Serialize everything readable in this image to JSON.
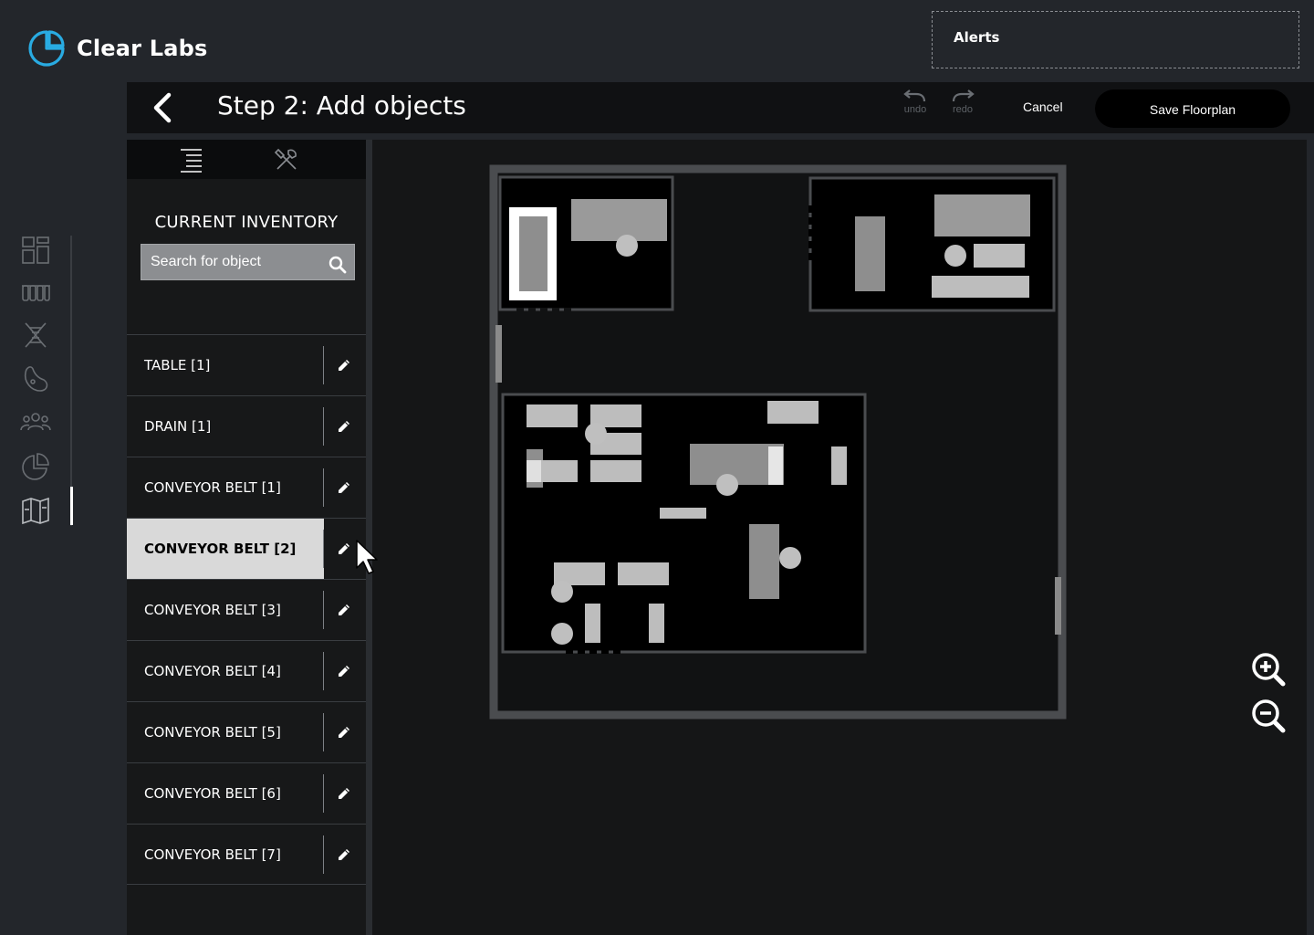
{
  "brand": {
    "name": "Clear Labs",
    "accent": "#29abe2"
  },
  "alerts": {
    "label": "Alerts"
  },
  "nav": {
    "icons": [
      "dashboard-icon",
      "test-tubes-icon",
      "dna-icon",
      "bacteria-icon",
      "users-icon",
      "pie-chart-icon",
      "floorplan-map-icon"
    ],
    "active": "floorplan-map-icon"
  },
  "header": {
    "title": "Step 2: Add objects",
    "undo": "undo",
    "redo": "redo",
    "cancel": "Cancel",
    "save": "Save Floorplan"
  },
  "sidebar": {
    "tabs": [
      "list-icon",
      "tools-icon"
    ],
    "title": "CURRENT INVENTORY",
    "search_placeholder": "Search for object",
    "items": [
      {
        "label": "TABLE [1]"
      },
      {
        "label": "DRAIN [1]"
      },
      {
        "label": "CONVEYOR BELT [1]"
      },
      {
        "label": "CONVEYOR BELT [2]",
        "selected": true
      },
      {
        "label": "CONVEYOR BELT [3]"
      },
      {
        "label": "CONVEYOR BELT [4]"
      },
      {
        "label": "CONVEYOR BELT [5]"
      },
      {
        "label": "CONVEYOR BELT [6]"
      },
      {
        "label": "CONVEYOR BELT [7]"
      }
    ]
  },
  "canvas": {
    "zoom_in": "zoom-in-icon",
    "zoom_out": "zoom-out-icon"
  }
}
